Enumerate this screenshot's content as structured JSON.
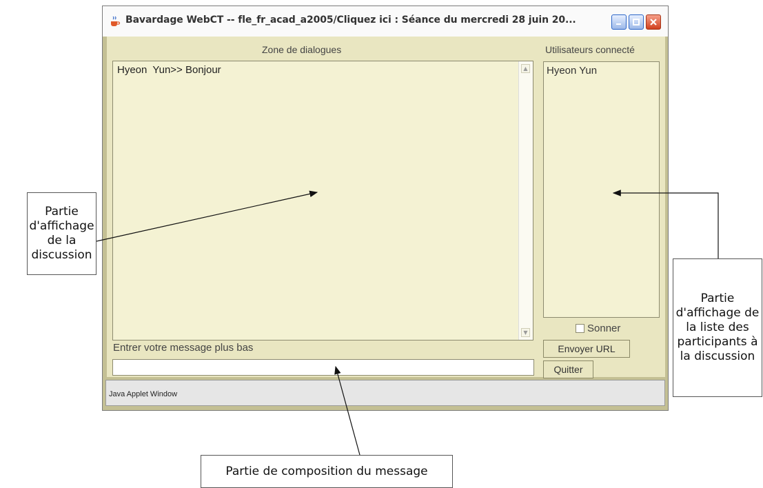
{
  "window": {
    "title": "Bavardage WebCT -- fle_fr_acad_a2005/Cliquez ici : Séance du mercredi 28 juin 20...",
    "title_icon": "java-cup-icon",
    "controls": [
      "minimize-icon",
      "maximize-icon",
      "close-icon"
    ]
  },
  "applet": {
    "dialog_zone_label": "Zone de dialogues",
    "dialog_lines": [
      "Hyeon  Yun>> Bonjour"
    ],
    "users_label": "Utilisateurs connecté",
    "users": [
      "Hyeon Yun"
    ],
    "ring_label": "Sonner",
    "ring_checked": false,
    "send_url_label": "Envoyer URL",
    "quit_label": "Quitter",
    "input_label": "Entrer votre message plus bas",
    "input_value": ""
  },
  "status_bar": {
    "text": "Java Applet Window"
  },
  "annotations": {
    "discussion": "Partie d'affichage de la discussion",
    "participants": "Partie d'affichage de la liste des participants à la discussion",
    "composition": "Partie de composition du message"
  },
  "colors": {
    "panel": "#e9e6c1",
    "frame": "#c4c094",
    "field": "#f4f2d3"
  }
}
